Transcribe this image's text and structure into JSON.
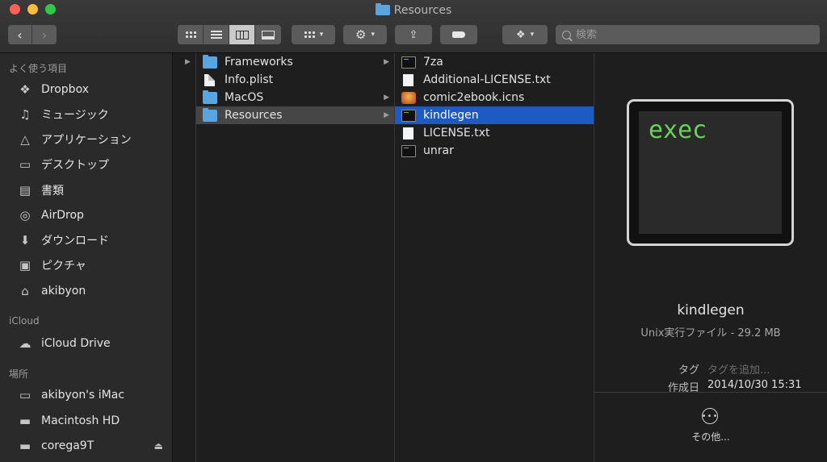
{
  "window": {
    "title": "Resources"
  },
  "search": {
    "placeholder": "検索"
  },
  "sidebar": {
    "sections": [
      {
        "heading": "よく使う項目",
        "items": [
          {
            "label": "Dropbox",
            "icon": "dropbox-icon"
          },
          {
            "label": "ミュージック",
            "icon": "music-icon"
          },
          {
            "label": "アプリケーション",
            "icon": "applications-icon"
          },
          {
            "label": "デスクトップ",
            "icon": "desktop-icon"
          },
          {
            "label": "書類",
            "icon": "documents-icon"
          },
          {
            "label": "AirDrop",
            "icon": "airdrop-icon"
          },
          {
            "label": "ダウンロード",
            "icon": "downloads-icon"
          },
          {
            "label": "ピクチャ",
            "icon": "pictures-icon"
          },
          {
            "label": "akibyon",
            "icon": "home-icon"
          }
        ]
      },
      {
        "heading": "iCloud",
        "items": [
          {
            "label": "iCloud Drive",
            "icon": "cloud-icon"
          }
        ]
      },
      {
        "heading": "場所",
        "items": [
          {
            "label": "akibyon's iMac",
            "icon": "imac-icon"
          },
          {
            "label": "Macintosh HD",
            "icon": "hard-drive-icon"
          },
          {
            "label": "corega9T",
            "icon": "external-drive-icon"
          }
        ]
      }
    ]
  },
  "columns": {
    "col2": [
      {
        "name": "Frameworks",
        "type": "folder",
        "arrow": true
      },
      {
        "name": "Info.plist",
        "type": "document",
        "arrow": false
      },
      {
        "name": "MacOS",
        "type": "folder",
        "arrow": true
      },
      {
        "name": "Resources",
        "type": "folder",
        "arrow": true,
        "selected": true
      }
    ],
    "col3": [
      {
        "name": "7za",
        "type": "exec"
      },
      {
        "name": "Additional-LICENSE.txt",
        "type": "text"
      },
      {
        "name": "comic2ebook.icns",
        "type": "icns"
      },
      {
        "name": "kindlegen",
        "type": "exec",
        "selected": true
      },
      {
        "name": "LICENSE.txt",
        "type": "text"
      },
      {
        "name": "unrar",
        "type": "exec"
      }
    ]
  },
  "preview": {
    "icon_text": "exec",
    "name": "kindlegen",
    "kind": "Unix実行ファイル - 29.2 MB",
    "tag_label": "タグ",
    "tag_placeholder": "タグを追加...",
    "created_label": "作成日",
    "created_value": "2014/10/30 15:31",
    "more_label": "その他..."
  },
  "colors": {
    "selection": "#1e5ac4",
    "folder": "#5aa5e0",
    "exec_text": "#69d25a"
  }
}
